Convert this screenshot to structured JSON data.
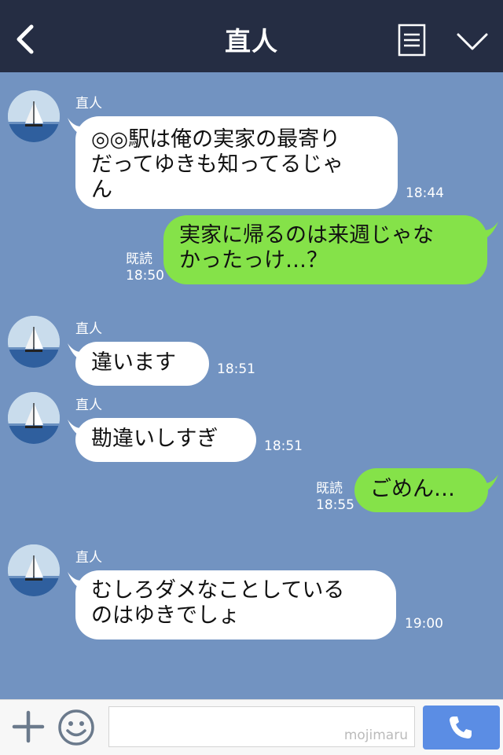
{
  "header": {
    "title": "直人",
    "back_icon": "chevron-left-icon",
    "menu_icon": "menu-icon",
    "collapse_icon": "chevron-down-icon",
    "background": "#252d43"
  },
  "chat": {
    "background": "#7293c1",
    "incoming_bubble_color": "#ffffff",
    "outgoing_bubble_color": "#85e249",
    "messages": [
      {
        "direction": "in",
        "sender": "直人",
        "text": "◎◎駅は俺の実家の最寄りだってゆきも知ってるじゃん",
        "lines": [
          "◎◎駅は俺の実家の最寄り",
          "だってゆきも知ってるじゃ",
          "ん"
        ],
        "time": "18:44"
      },
      {
        "direction": "out",
        "read": "既読",
        "text": "実家に帰るのは来週じゃなかったっけ…？",
        "lines": [
          "実家に帰るのは来週じゃな",
          "かったっけ…？"
        ],
        "time": "18:50"
      },
      {
        "direction": "in",
        "sender": "直人",
        "text": "違います",
        "lines": [
          "違います"
        ],
        "time": "18:51"
      },
      {
        "direction": "in",
        "sender": "直人",
        "text": "勘違いしすぎ",
        "lines": [
          "勘違いしすぎ"
        ],
        "time": "18:51"
      },
      {
        "direction": "out",
        "read": "既読",
        "text": "ごめん…",
        "lines": [
          "ごめん…"
        ],
        "time": "18:55"
      },
      {
        "direction": "in",
        "sender": "直人",
        "text": "むしろダメなことしているのはゆきでしょ",
        "lines": [
          "むしろダメなことしている",
          "のはゆきでしょ"
        ],
        "time": "19:00"
      }
    ]
  },
  "footer": {
    "plus_icon": "plus-icon",
    "emoji_icon": "smiley-icon",
    "input_value": "",
    "watermark": "mojimaru",
    "call_icon": "phone-icon",
    "call_button_color": "#5b8de4"
  }
}
